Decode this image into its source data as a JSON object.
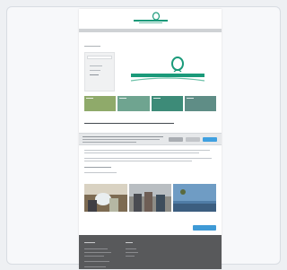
{
  "colors": {
    "brand_green": "#1a9a7a",
    "tile_colors": [
      "#8faa6a",
      "#6fa490",
      "#3d8b78",
      "#5f8d86"
    ],
    "cookie_accept": "#3fa0e0",
    "cookie_settings": "#a9adb2",
    "cookie_reject": "#c2c5c9",
    "footer_bg": "#58595b"
  },
  "header": {
    "logo_icon": "logo-leaf-icon"
  },
  "hero": {
    "logo_icon": "logo-leaf-icon"
  },
  "icons": [
    "logo-leaf-icon",
    "search-icon"
  ]
}
